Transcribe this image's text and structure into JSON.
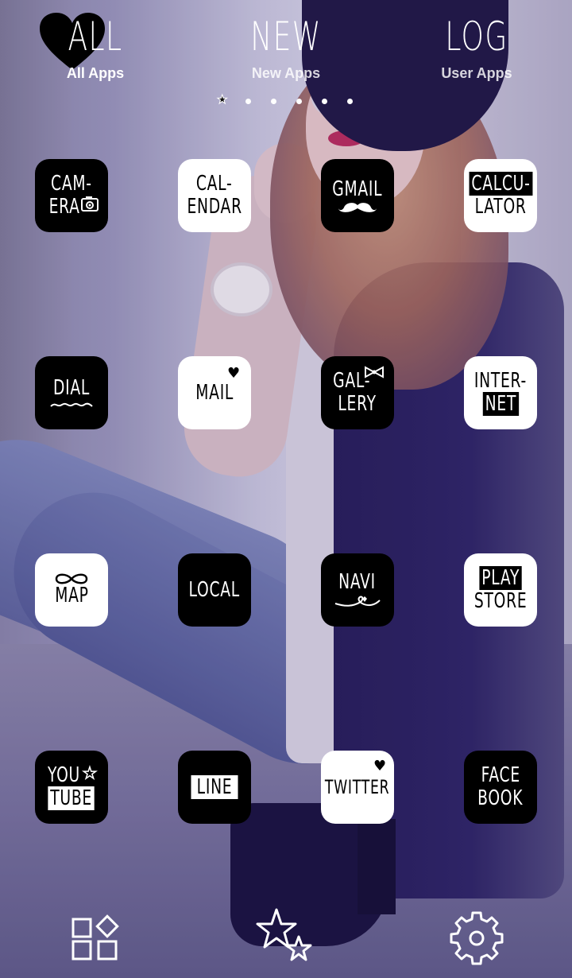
{
  "header": {
    "tabs": [
      {
        "hand": "ALL",
        "label": "All Apps",
        "active": true
      },
      {
        "hand": "NEW",
        "label": "New Apps",
        "active": false
      },
      {
        "hand": "LOG",
        "label": "User Apps",
        "active": false
      }
    ],
    "page_indicator": {
      "pages": 6,
      "current": 1
    }
  },
  "apps": [
    {
      "l1": "CAM-",
      "l2": "ERA",
      "icon": "camera-icon"
    },
    {
      "l1": "CAL-",
      "l2": "ENDAR"
    },
    {
      "l1": "GMAIL",
      "icon": "mustache-icon"
    },
    {
      "l1": "CALCU-",
      "l2": "LATOR"
    },
    {
      "l1": "DIAL",
      "icon": "squiggle-icon"
    },
    {
      "l1": "MAIL",
      "icon": "heart-icon"
    },
    {
      "l1": "GAL-",
      "l2": "LERY",
      "icon": "bow-icon"
    },
    {
      "l1": "INTER-",
      "l2": "NET"
    },
    {
      "l1": "MAP",
      "icon": "infinity-icon"
    },
    {
      "l1": "LOCAL"
    },
    {
      "l1": "NAVI",
      "icon": "heart-swirl-icon"
    },
    {
      "l1": "PLAY",
      "l2": "STORE"
    },
    {
      "l1": "YOU",
      "l2": "TUBE",
      "icon": "star-icon"
    },
    {
      "l1": "LINE"
    },
    {
      "l1": "TWITTER",
      "icon": "heart-icon"
    },
    {
      "l1": "FACE",
      "l2": "BOOK"
    }
  ],
  "dock": {
    "items": [
      {
        "icon": "widgets-icon"
      },
      {
        "icon": "stars-icon"
      },
      {
        "icon": "gear-icon"
      }
    ]
  }
}
